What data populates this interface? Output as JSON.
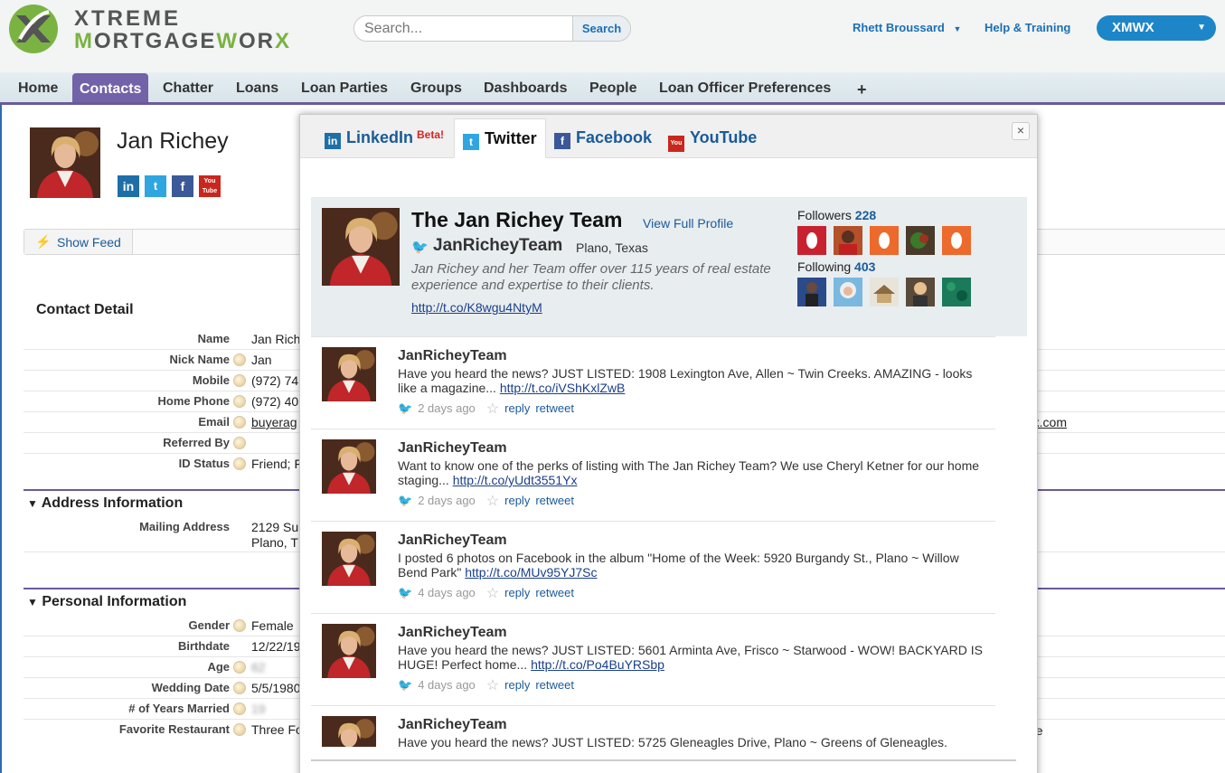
{
  "header": {
    "logo_line1": "XTREME",
    "logo_line2_a": "M",
    "logo_line2_b": "ORTGAGE",
    "logo_line2_c": "W",
    "logo_line2_d": "OR",
    "logo_line2_e": "X",
    "search_placeholder": "Search...",
    "search_button": "Search",
    "user_name": "Rhett Broussard",
    "help_link": "Help & Training",
    "app_name": "XMWX",
    "accent": "#1d86c8"
  },
  "tabs": [
    "Home",
    "Contacts",
    "Chatter",
    "Loans",
    "Loan Parties",
    "Groups",
    "Dashboards",
    "People",
    "Loan Officer Preferences",
    "+"
  ],
  "active_tab": "Contacts",
  "contact": {
    "name": "Jan Richey",
    "social_icons": [
      "in",
      "t",
      "f",
      "You Tube"
    ],
    "show_feed": "Show Feed"
  },
  "detail": {
    "title": "Contact Detail",
    "rows": [
      {
        "label": "Name",
        "value": "Jan Rich"
      },
      {
        "label": "Nick Name",
        "value": "Jan"
      },
      {
        "label": "Mobile",
        "value": "(972) 74"
      },
      {
        "label": "Home Phone",
        "value": "(972) 40"
      },
      {
        "label": "Email",
        "value": "buyerag"
      },
      {
        "label": "Referred By",
        "value": ""
      },
      {
        "label": "ID Status",
        "value": "Friend; F"
      }
    ],
    "email_tail": "rx.com",
    "address_section": "Address Information",
    "mailing_label": "Mailing Address",
    "mailing_line1": "2129 Su",
    "mailing_line2": "Plano, T",
    "personal_section": "Personal Information",
    "personal_rows": [
      {
        "label": "Gender",
        "value": "Female"
      },
      {
        "label": "Birthdate",
        "value": "12/22/19"
      },
      {
        "label": "Age",
        "value": "62"
      },
      {
        "label": "Wedding Date",
        "value": "5/5/1980"
      },
      {
        "label": "# of Years Married",
        "value": "19"
      },
      {
        "label": "Favorite Restaurant",
        "value": "Three Fo"
      }
    ],
    "restaurant_tail": "ge"
  },
  "popup": {
    "tabs": [
      {
        "label": "LinkedIn",
        "icon": "in"
      },
      {
        "label": "Twitter",
        "icon": "t"
      },
      {
        "label": "Facebook",
        "icon": "f"
      },
      {
        "label": "YouTube",
        "icon": "You"
      }
    ],
    "beta": "Beta!",
    "active_tab": "Twitter",
    "close": "×",
    "profile": {
      "name": "The Jan Richey Team",
      "view_full": "View Full Profile",
      "handle": "JanRicheyTeam",
      "location": "Plano, Texas",
      "bio": "Jan Richey and her Team offer over 115 years of real estate experience and expertise to their clients.",
      "url": "http://t.co/K8wgu4NtyM",
      "followers_label": "Followers",
      "followers_count": "228",
      "following_label": "Following",
      "following_count": "403"
    },
    "tweets": [
      {
        "user": "JanRicheyTeam",
        "text": "Have you heard the news? JUST LISTED: 1908 Lexington Ave, Allen ~ Twin Creeks. AMAZING - looks like a magazine... ",
        "link": "http://t.co/iVShKxlZwB",
        "time": "2 days ago",
        "reply": "reply",
        "retweet": "retweet"
      },
      {
        "user": "JanRicheyTeam",
        "text": "Want to know one of the perks of listing with The Jan Richey Team? We use Cheryl Ketner for our home staging... ",
        "link": "http://t.co/yUdt3551Yx",
        "time": "2 days ago",
        "reply": "reply",
        "retweet": "retweet"
      },
      {
        "user": "JanRicheyTeam",
        "text": "I posted 6 photos on Facebook in the album \"Home of the Week: 5920 Burgandy St., Plano ~ Willow Bend Park\" ",
        "link": "http://t.co/MUv95YJ7Sc",
        "time": "4 days ago",
        "reply": "reply",
        "retweet": "retweet"
      },
      {
        "user": "JanRicheyTeam",
        "text": "Have you heard the news? JUST LISTED: 5601 Arminta Ave, Frisco ~ Starwood - WOW! BACKYARD IS HUGE! Perfect home... ",
        "link": "http://t.co/Po4BuYRSbp",
        "time": "4 days ago",
        "reply": "reply",
        "retweet": "retweet"
      },
      {
        "user": "JanRicheyTeam",
        "text": "Have you heard the news? JUST LISTED: 5725 Gleneagles Drive, Plano ~ Greens of Gleneagles.",
        "link": "",
        "time": "",
        "reply": "",
        "retweet": ""
      }
    ]
  }
}
